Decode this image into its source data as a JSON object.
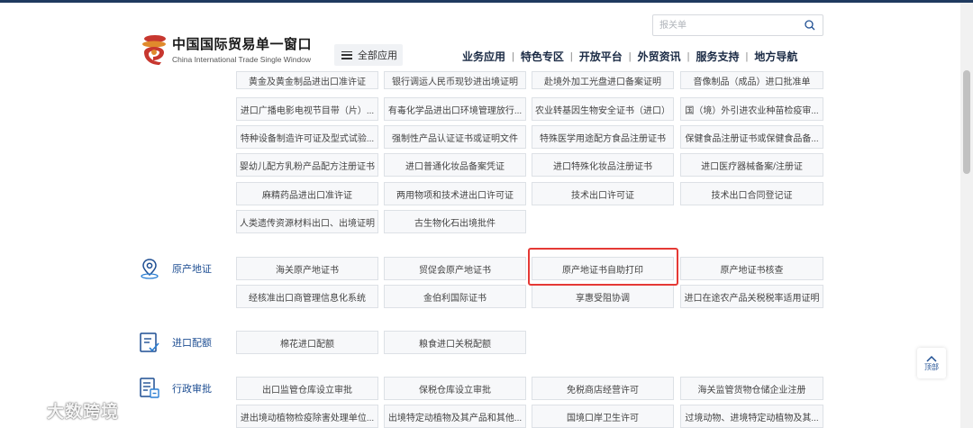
{
  "header": {
    "logo_cn": "中国国际贸易单一窗口",
    "logo_en": "China International Trade Single Window",
    "all_apps": "全部应用",
    "search_placeholder": "报关单",
    "nav": [
      "业务应用",
      "特色专区",
      "开放平台",
      "外贸资讯",
      "服务支持",
      "地方导航"
    ]
  },
  "permits": {
    "partial_row": [
      "黄金及黄金制品进出口准许证",
      "银行调运人民币现钞进出境证明",
      "赴境外加工光盘进口备案证明",
      "音像制品（成品）进口批准单"
    ],
    "rows": [
      [
        "进口广播电影电视节目带（片）...",
        "有毒化学品进出口环境管理放行...",
        "农业转基因生物安全证书（进口）",
        "国（境）外引进农业种苗检疫审..."
      ],
      [
        "特种设备制造许可证及型式试验...",
        "强制性产品认证证书或证明文件",
        "特殊医学用途配方食品注册证书",
        "保健食品注册证书或保健食品备..."
      ],
      [
        "婴幼儿配方乳粉产品配方注册证书",
        "进口普通化妆品备案凭证",
        "进口特殊化妆品注册证书",
        "进口医疗器械备案/注册证"
      ],
      [
        "麻精药品进出口准许证",
        "两用物项和技术进出口许可证",
        "技术出口许可证",
        "技术出口合同登记证"
      ],
      [
        "人类遗传资源材料出口、出境证明",
        "古生物化石出境批件"
      ]
    ]
  },
  "origin": {
    "label": "原产地证",
    "rows": [
      [
        "海关原产地证书",
        "贸促会原产地证书",
        "原产地证书自助打印",
        "原产地证书核查"
      ],
      [
        "经核准出口商管理信息化系统",
        "金伯利国际证书",
        "享惠受阻协调",
        "进口在途农产品关税税率适用证明"
      ]
    ]
  },
  "quota": {
    "label": "进口配额",
    "items": [
      "棉花进口配额",
      "粮食进口关税配额"
    ]
  },
  "admin": {
    "label": "行政审批",
    "rows": [
      [
        "出口监管仓库设立审批",
        "保税仓库设立审批",
        "免税商店经营许可",
        "海关监管货物仓储企业注册"
      ],
      [
        "进出境动植物检疫除害处理单位...",
        "出境特定动植物及其产品和其他...",
        "国境口岸卫生许可",
        "过境动物、进境特定动植物及其..."
      ]
    ]
  },
  "to_top": "顶部",
  "watermark": "大数跨境",
  "colors": {
    "accent": "#1f4f93",
    "highlight": "#e53935"
  }
}
